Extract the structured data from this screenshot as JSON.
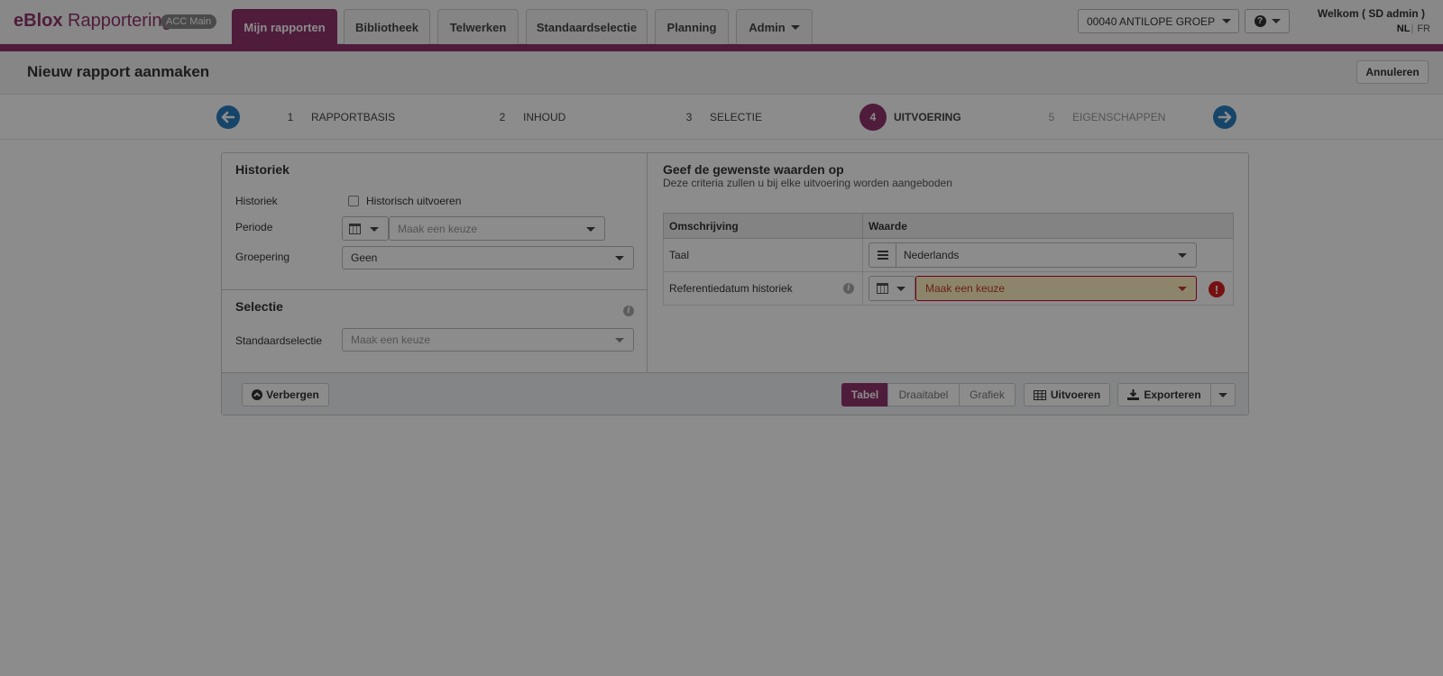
{
  "header": {
    "brand_bold": "eBlox",
    "brand_rest": " Rapportering",
    "env_badge": "ACC Main",
    "tabs": [
      {
        "label": "Mijn rapporten",
        "active": true
      },
      {
        "label": "Bibliotheek"
      },
      {
        "label": "Telwerken"
      },
      {
        "label": "Standaardselectie"
      },
      {
        "label": "Planning"
      },
      {
        "label": "Admin"
      }
    ],
    "organisation": "00040 ANTILOPE GROEP",
    "welcome": "Welkom ( SD admin )",
    "lang_nl": "NL",
    "lang_sep": "|",
    "lang_fr": "FR"
  },
  "page": {
    "title": "Nieuw rapport aanmaken",
    "cancel_label": "Annuleren"
  },
  "wizard": {
    "steps": [
      {
        "num": "1",
        "label": "RAPPORTBASIS"
      },
      {
        "num": "2",
        "label": "INHOUD"
      },
      {
        "num": "3",
        "label": "SELECTIE"
      },
      {
        "num": "4",
        "label": "UITVOERING",
        "active": true
      },
      {
        "num": "5",
        "label": "EIGENSCHAPPEN"
      }
    ]
  },
  "historiek": {
    "title": "Historiek",
    "historiek_label": "Historiek",
    "checkbox_label": "Historisch uitvoeren",
    "periode_label": "Periode",
    "periode_placeholder": "Maak een keuze",
    "groepering_label": "Groepering",
    "groepering_value": "Geen"
  },
  "selectie": {
    "title": "Selectie",
    "standaard_label": "Standaardselectie",
    "standaard_placeholder": "Maak een keuze"
  },
  "criteria": {
    "title": "Geef de gewenste waarden op",
    "subtitle": "Deze criteria zullen u bij elke uitvoering worden aangeboden",
    "col_desc": "Omschrijving",
    "col_value": "Waarde",
    "rows": [
      {
        "desc": "Taal",
        "value": "Nederlands"
      },
      {
        "desc": "Referentiedatum historiek",
        "value": "Maak een keuze"
      }
    ]
  },
  "footer": {
    "hide_label": "Verbergen",
    "view_tabel": "Tabel",
    "view_draaitabel": "Draaitabel",
    "view_grafiek": "Grafiek",
    "run_label": "Uitvoeren",
    "export_label": "Exporteren"
  },
  "colors": {
    "brand": "#91336e",
    "nav_arrow": "#2a7fc0",
    "error": "#d9201f"
  }
}
